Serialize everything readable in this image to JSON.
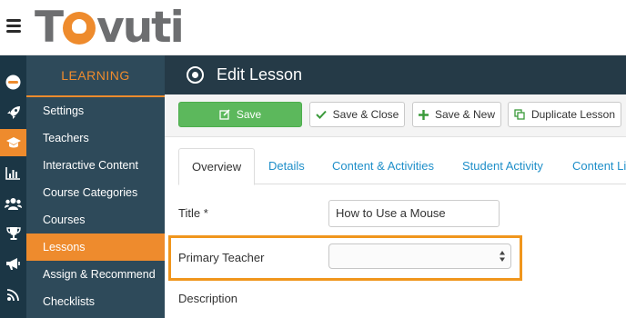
{
  "header": {
    "logo_text_1": "T",
    "logo_text_2": "vuti",
    "menu_icon": "hamburger-menu-icon"
  },
  "rail": {
    "icons": [
      "logo-badge-icon",
      "rocket-icon",
      "graduation-cap-icon",
      "bar-chart-icon",
      "users-icon",
      "trophy-icon",
      "megaphone-icon",
      "broadcast-icon"
    ]
  },
  "sidebar": {
    "heading": "LEARNING",
    "items": [
      {
        "label": "Settings",
        "active": false
      },
      {
        "label": "Teachers",
        "active": false
      },
      {
        "label": "Interactive Content",
        "active": false
      },
      {
        "label": "Course Categories",
        "active": false
      },
      {
        "label": "Courses",
        "active": false
      },
      {
        "label": "Lessons",
        "active": true
      },
      {
        "label": "Assign & Recommend",
        "active": false
      },
      {
        "label": "Checklists",
        "active": false
      }
    ]
  },
  "page": {
    "title": "Edit Lesson",
    "title_icon": "record-circle-icon"
  },
  "toolbar": {
    "save": "Save",
    "save_close": "Save & Close",
    "save_new": "Save & New",
    "duplicate": "Duplicate Lesson"
  },
  "tabs": [
    "Overview",
    "Details",
    "Content & Activities",
    "Student Activity",
    "Content Li"
  ],
  "form": {
    "title_label": "Title *",
    "title_value": "How to Use a Mouse",
    "primary_teacher_label": "Primary Teacher",
    "primary_teacher_value": "",
    "description_label": "Description"
  },
  "colors": {
    "accent": "#ee8b2d",
    "rail": "#1b3645",
    "sidebar": "#2e4a5a",
    "titlebar": "#253a47",
    "primary_button": "#5cb85c",
    "link": "#1f8fc9",
    "highlight": "#f0961d"
  }
}
